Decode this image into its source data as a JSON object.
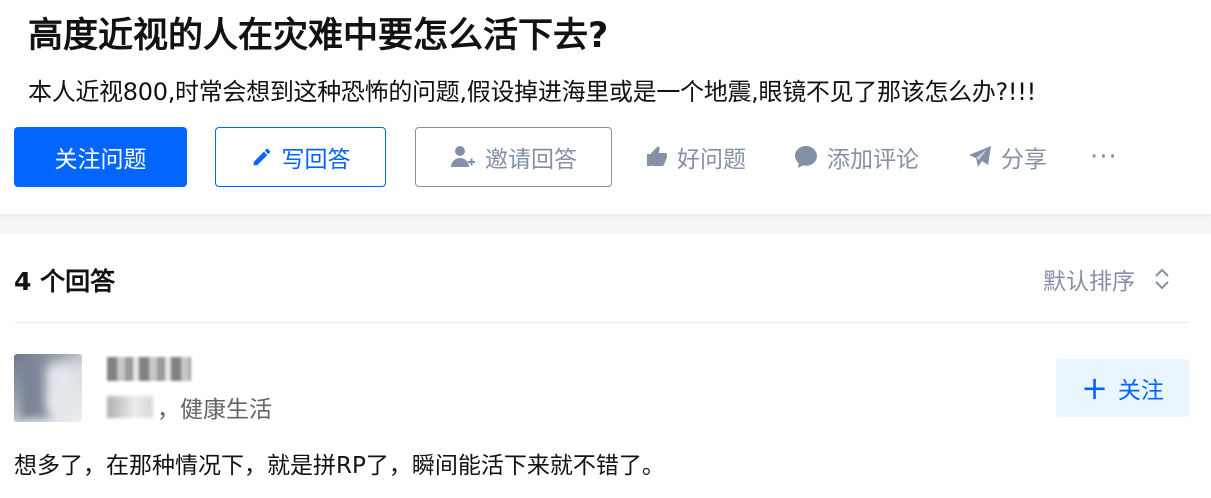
{
  "question": {
    "title": "高度近视的人在灾难中要怎么活下去?",
    "detail": "本人近视800,时常会想到这种恐怖的问题,假设掉进海里或是一个地震,眼镜不见了那该怎么办?!!!"
  },
  "actions": {
    "follow_question": "关注问题",
    "write_answer": "写回答",
    "invite_answer": "邀请回答",
    "good_question": "好问题",
    "add_comment": "添加评论",
    "share": "分享",
    "more": "···"
  },
  "answers": {
    "count_label": "4 个回答",
    "sort_label": "默认排序",
    "items": [
      {
        "bio": "，健康生活",
        "follow_label": "关注",
        "content": "想多了，在那种情况下，就是拼RP了，瞬间能活下来就不错了。"
      }
    ]
  },
  "icons": {
    "write": "pencil-icon",
    "invite": "add-user-icon",
    "good": "thumbs-up-icon",
    "comment": "comment-bubble-icon",
    "share": "paper-plane-icon",
    "sort": "sort-chevrons-icon"
  },
  "colors": {
    "brand": "#0066ff",
    "muted": "#8590a6",
    "follow_bg": "#ebf5ff"
  }
}
